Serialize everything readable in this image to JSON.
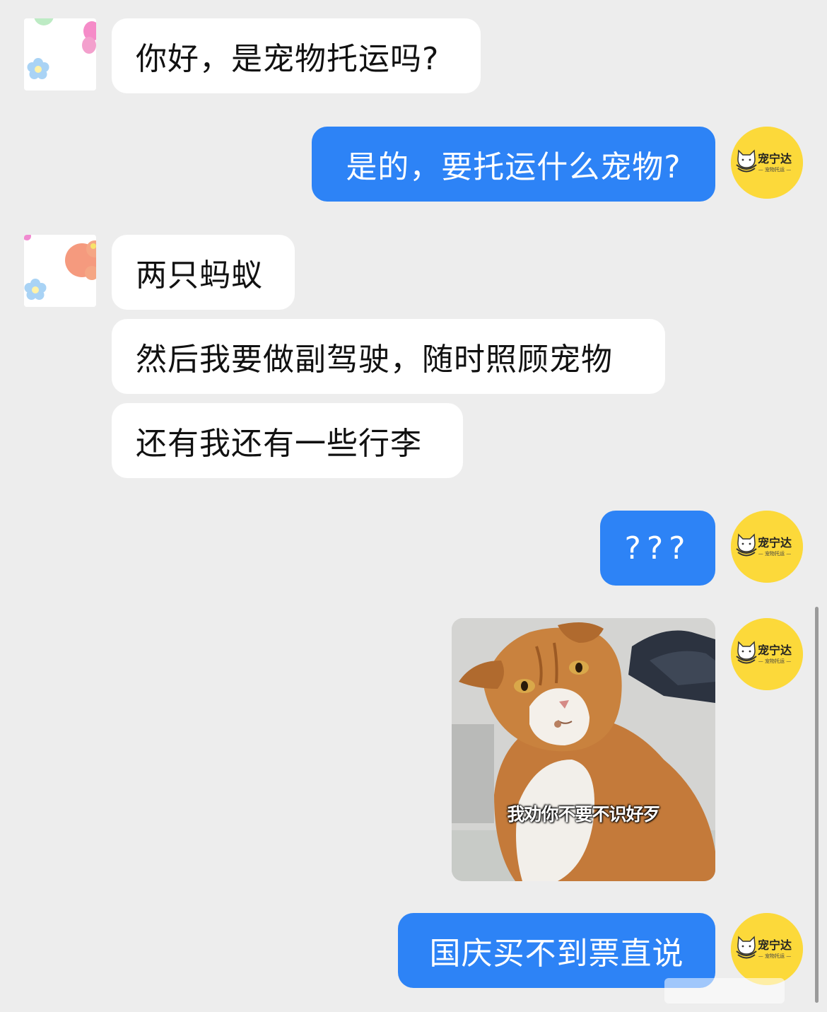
{
  "messages": [
    {
      "side": "in",
      "text": "你好，是宠物托运吗?"
    },
    {
      "side": "out",
      "text": "是的，要托运什么宠物?"
    },
    {
      "side": "in",
      "text": "两只蚂蚁"
    },
    {
      "side": "in",
      "text": "然后我要做副驾驶，随时照顾宠物"
    },
    {
      "side": "in",
      "text": "还有我还有一些行李"
    },
    {
      "side": "out",
      "text": "???"
    },
    {
      "side": "out",
      "type": "image",
      "caption": "我劝你不要不识好歹"
    },
    {
      "side": "out",
      "text": "国庆买不到票直说"
    }
  ],
  "agent_avatar": {
    "brand": "宠宁达",
    "tagline": "— 宠物托运 —",
    "color": "#FCD93A"
  },
  "customer_avatar": {
    "icon": "flower-icon"
  },
  "colors": {
    "background": "#EDEDED",
    "outgoing_bubble": "#2D83F6",
    "incoming_bubble": "#FFFFFF"
  }
}
